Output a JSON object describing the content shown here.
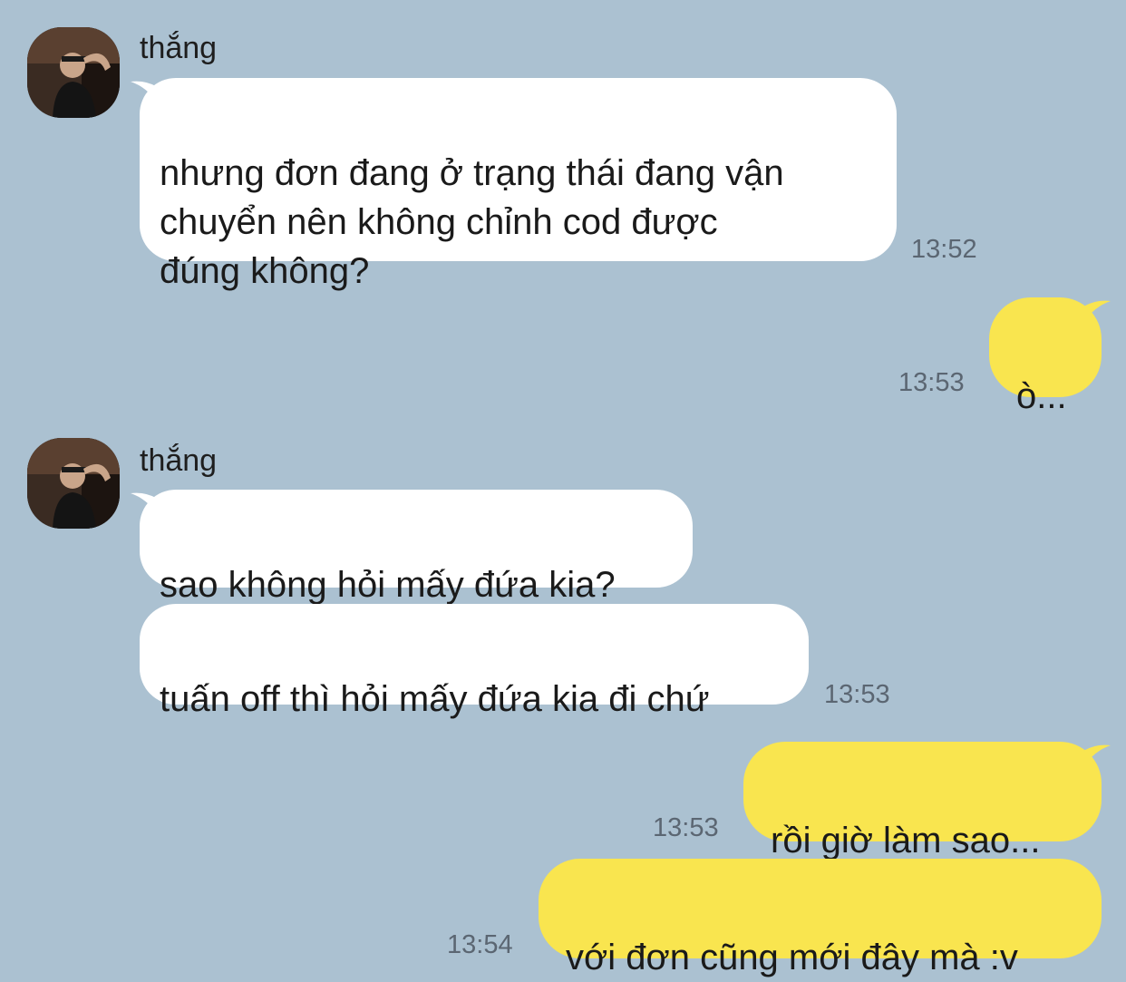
{
  "conversation": {
    "sender_name": "thắng",
    "messages": [
      {
        "from": "thắng",
        "text": "nhưng đơn đang ở trạng thái đang vận\nchuyển nên không chỉnh cod được\nđúng không?",
        "time": "13:52"
      },
      {
        "from": "me",
        "text": "ò...",
        "time": "13:53"
      },
      {
        "from": "thắng",
        "text": "sao không hỏi mấy đứa kia?",
        "time": ""
      },
      {
        "from": "thắng",
        "text": "tuấn off thì hỏi mấy đứa kia đi chứ",
        "time": "13:53"
      },
      {
        "from": "me",
        "text": "rồi giờ làm sao...",
        "time": "13:53"
      },
      {
        "from": "me",
        "text": "với đơn cũng mới đây mà :v",
        "time": "13:54"
      }
    ]
  },
  "colors": {
    "background": "#abc1d1",
    "incoming_bubble": "#ffffff",
    "outgoing_bubble": "#f9e54f",
    "timestamp": "#5b6672"
  }
}
